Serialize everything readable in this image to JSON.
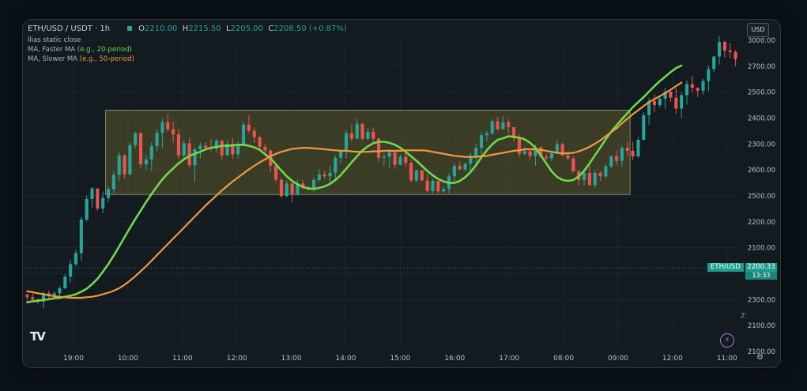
{
  "header": {
    "symbol": "ETH/USD / USDT · 1h",
    "o_label": "O",
    "o_value": "2210.00",
    "h_label": "H",
    "h_value": "2215.50",
    "l_label": "L",
    "l_value": "2205.00",
    "c_label": "C",
    "c_value": "2208.50",
    "change": "(+0.87%)",
    "sub1": "llias static  close",
    "ma_fast_label": "MA, Faster MA",
    "ma_fast_note": "(e.g., 20-period)",
    "ma_slow_label": "MA, Slower MA",
    "ma_slow_note": "(e.g., 50-period)"
  },
  "currency_button": "USD",
  "price_tag": {
    "name": "ETH/USD",
    "value": "2200.33",
    "time": "13:33"
  },
  "stray_mark": "2'",
  "colors": {
    "up": "#26a69a",
    "down": "#ef5350",
    "ma_fast": "#6fd94a",
    "ma_slow": "#f09a3e",
    "range_fill": "#5c5a2c",
    "range_border": "#8a8a6a"
  },
  "icons": {
    "logo": "tradingview-logo-icon",
    "bolt": "lightning-icon",
    "gear": "gear-icon"
  },
  "chart_data": {
    "type": "candlestick",
    "x_tick_labels": [
      "19:00",
      "10:00",
      "11:00",
      "12:00",
      "13:00",
      "14:00",
      "15:00",
      "16:00",
      "17:00",
      "08:00",
      "09:00",
      "12:00",
      "11:00"
    ],
    "y_tick_labels": [
      "3000.00",
      "2700.00",
      "2500.00",
      "2400.00",
      "2300.00",
      "2600.00",
      "2500.00",
      "2200.00",
      "2100.00",
      "2200.00",
      "2300.00",
      "2100.00",
      "2100.00"
    ],
    "ylim": [
      2160,
      2790
    ],
    "grid": true,
    "range_box": {
      "from_index": 15,
      "to_index": 111,
      "top": 2638,
      "bottom": 2470
    },
    "candles": [
      [
        2270,
        2272,
        2259,
        2265
      ],
      [
        2265,
        2272,
        2256,
        2261
      ],
      [
        2261,
        2263,
        2252,
        2256
      ],
      [
        2256,
        2277,
        2243,
        2273
      ],
      [
        2273,
        2279,
        2263,
        2267
      ],
      [
        2267,
        2277,
        2264,
        2273
      ],
      [
        2273,
        2287,
        2260,
        2283
      ],
      [
        2283,
        2311,
        2281,
        2306
      ],
      [
        2306,
        2339,
        2294,
        2331
      ],
      [
        2331,
        2360,
        2327,
        2353
      ],
      [
        2353,
        2425,
        2338,
        2420
      ],
      [
        2420,
        2468,
        2417,
        2461
      ],
      [
        2461,
        2485,
        2444,
        2482
      ],
      [
        2482,
        2480,
        2438,
        2442
      ],
      [
        2442,
        2476,
        2433,
        2463
      ],
      [
        2463,
        2486,
        2454,
        2481
      ],
      [
        2481,
        2516,
        2473,
        2509
      ],
      [
        2509,
        2555,
        2497,
        2548
      ],
      [
        2548,
        2550,
        2502,
        2510
      ],
      [
        2510,
        2573,
        2509,
        2568
      ],
      [
        2568,
        2595,
        2562,
        2592
      ],
      [
        2592,
        2595,
        2523,
        2530
      ],
      [
        2530,
        2548,
        2520,
        2540
      ],
      [
        2540,
        2574,
        2516,
        2566
      ],
      [
        2566,
        2600,
        2556,
        2593
      ],
      [
        2593,
        2621,
        2563,
        2614
      ],
      [
        2614,
        2630,
        2595,
        2600
      ],
      [
        2600,
        2615,
        2573,
        2590
      ],
      [
        2590,
        2601,
        2540,
        2548
      ],
      [
        2548,
        2578,
        2539,
        2572
      ],
      [
        2572,
        2583,
        2523,
        2528
      ],
      [
        2528,
        2564,
        2494,
        2560
      ],
      [
        2560,
        2574,
        2541,
        2567
      ],
      [
        2567,
        2574,
        2557,
        2563
      ],
      [
        2563,
        2580,
        2556,
        2561
      ],
      [
        2561,
        2581,
        2553,
        2577
      ],
      [
        2577,
        2579,
        2539,
        2548
      ],
      [
        2548,
        2578,
        2547,
        2571
      ],
      [
        2571,
        2582,
        2541,
        2550
      ],
      [
        2550,
        2576,
        2542,
        2568
      ],
      [
        2568,
        2614,
        2566,
        2609
      ],
      [
        2609,
        2628,
        2592,
        2597
      ],
      [
        2597,
        2603,
        2573,
        2584
      ],
      [
        2584,
        2588,
        2558,
        2565
      ],
      [
        2565,
        2571,
        2549,
        2558
      ],
      [
        2558,
        2560,
        2515,
        2527
      ],
      [
        2527,
        2531,
        2495,
        2499
      ],
      [
        2499,
        2503,
        2463,
        2467
      ],
      [
        2467,
        2498,
        2464,
        2492
      ],
      [
        2492,
        2491,
        2455,
        2471
      ],
      [
        2471,
        2499,
        2468,
        2492
      ],
      [
        2492,
        2498,
        2480,
        2483
      ],
      [
        2483,
        2487,
        2478,
        2480
      ],
      [
        2480,
        2504,
        2476,
        2499
      ],
      [
        2499,
        2520,
        2495,
        2510
      ],
      [
        2510,
        2517,
        2501,
        2506
      ],
      [
        2506,
        2527,
        2493,
        2513
      ],
      [
        2513,
        2548,
        2499,
        2543
      ],
      [
        2543,
        2560,
        2532,
        2557
      ],
      [
        2557,
        2598,
        2542,
        2592
      ],
      [
        2592,
        2610,
        2575,
        2581
      ],
      [
        2581,
        2621,
        2581,
        2611
      ],
      [
        2611,
        2612,
        2577,
        2581
      ],
      [
        2581,
        2602,
        2578,
        2595
      ],
      [
        2595,
        2604,
        2574,
        2581
      ],
      [
        2581,
        2583,
        2536,
        2543
      ],
      [
        2543,
        2553,
        2528,
        2545
      ],
      [
        2545,
        2560,
        2522,
        2554
      ],
      [
        2554,
        2559,
        2521,
        2529
      ],
      [
        2529,
        2550,
        2528,
        2545
      ],
      [
        2545,
        2557,
        2526,
        2533
      ],
      [
        2533,
        2540,
        2494,
        2498
      ],
      [
        2498,
        2520,
        2494,
        2518
      ],
      [
        2518,
        2519,
        2497,
        2498
      ],
      [
        2498,
        2510,
        2474,
        2477
      ],
      [
        2477,
        2501,
        2473,
        2497
      ],
      [
        2497,
        2497,
        2470,
        2476
      ],
      [
        2476,
        2486,
        2473,
        2481
      ],
      [
        2481,
        2512,
        2472,
        2506
      ],
      [
        2506,
        2531,
        2496,
        2527
      ],
      [
        2527,
        2536,
        2518,
        2520
      ],
      [
        2520,
        2534,
        2516,
        2531
      ],
      [
        2531,
        2553,
        2516,
        2547
      ],
      [
        2547,
        2571,
        2529,
        2563
      ],
      [
        2563,
        2593,
        2546,
        2588
      ],
      [
        2588,
        2597,
        2576,
        2592
      ],
      [
        2592,
        2620,
        2589,
        2616
      ],
      [
        2616,
        2624,
        2598,
        2600
      ],
      [
        2600,
        2626,
        2600,
        2614
      ],
      [
        2614,
        2620,
        2593,
        2604
      ],
      [
        2604,
        2604,
        2575,
        2582
      ],
      [
        2582,
        2590,
        2544,
        2551
      ],
      [
        2551,
        2565,
        2548,
        2556
      ],
      [
        2556,
        2558,
        2539,
        2547
      ],
      [
        2547,
        2569,
        2527,
        2564
      ],
      [
        2564,
        2566,
        2543,
        2545
      ],
      [
        2545,
        2551,
        2538,
        2542
      ],
      [
        2542,
        2557,
        2536,
        2552
      ],
      [
        2552,
        2580,
        2552,
        2570
      ],
      [
        2570,
        2573,
        2546,
        2548
      ],
      [
        2548,
        2556,
        2538,
        2542
      ],
      [
        2542,
        2546,
        2514,
        2516
      ],
      [
        2516,
        2518,
        2488,
        2499
      ],
      [
        2499,
        2520,
        2488,
        2513
      ],
      [
        2513,
        2527,
        2486,
        2489
      ],
      [
        2489,
        2518,
        2482,
        2513
      ],
      [
        2513,
        2516,
        2497,
        2506
      ],
      [
        2506,
        2530,
        2502,
        2526
      ],
      [
        2526,
        2548,
        2522,
        2546
      ],
      [
        2546,
        2557,
        2528,
        2537
      ],
      [
        2537,
        2567,
        2525,
        2563
      ],
      [
        2563,
        2575,
        2546,
        2557
      ],
      [
        2557,
        2575,
        2538,
        2546
      ],
      [
        2546,
        2585,
        2543,
        2579
      ],
      [
        2579,
        2634,
        2578,
        2628
      ],
      [
        2628,
        2663,
        2609,
        2656
      ],
      [
        2656,
        2670,
        2634,
        2648
      ],
      [
        2648,
        2665,
        2643,
        2661
      ],
      [
        2661,
        2683,
        2641,
        2675
      ],
      [
        2675,
        2676,
        2655,
        2663
      ],
      [
        2663,
        2682,
        2630,
        2641
      ],
      [
        2641,
        2673,
        2622,
        2668
      ],
      [
        2668,
        2697,
        2649,
        2690
      ],
      [
        2690,
        2707,
        2674,
        2683
      ],
      [
        2683,
        2682,
        2664,
        2677
      ],
      [
        2677,
        2701,
        2669,
        2696
      ],
      [
        2696,
        2727,
        2676,
        2720
      ],
      [
        2720,
        2747,
        2714,
        2745
      ],
      [
        2745,
        2786,
        2729,
        2774
      ],
      [
        2774,
        2776,
        2743,
        2757
      ],
      [
        2757,
        2772,
        2742,
        2754
      ],
      [
        2754,
        2758,
        2726,
        2740
      ]
    ],
    "series": [
      {
        "name": "MA, Faster MA",
        "values": [
          2255,
          2257,
          2258,
          2260,
          2261,
          2263,
          2264,
          2266,
          2268,
          2271,
          2276,
          2282,
          2291,
          2302,
          2316,
          2331,
          2348,
          2366,
          2385,
          2403,
          2421,
          2438,
          2455,
          2471,
          2486,
          2500,
          2512,
          2522,
          2532,
          2540,
          2547,
          2551,
          2555,
          2560,
          2563,
          2565,
          2567,
          2567,
          2568,
          2569,
          2569,
          2567,
          2564,
          2559,
          2550,
          2542,
          2530,
          2518,
          2506,
          2497,
          2490,
          2485,
          2482,
          2481,
          2483,
          2486,
          2491,
          2499,
          2509,
          2521,
          2534,
          2546,
          2558,
          2566,
          2572,
          2575,
          2575,
          2573,
          2569,
          2563,
          2555,
          2546,
          2537,
          2527,
          2517,
          2508,
          2501,
          2496,
          2493,
          2493,
          2497,
          2504,
          2515,
          2528,
          2544,
          2558,
          2570,
          2579,
          2582,
          2586,
          2585,
          2583,
          2580,
          2573,
          2563,
          2548,
          2532,
          2516,
          2505,
          2499,
          2497,
          2499,
          2506,
          2517,
          2532,
          2548,
          2564,
          2580,
          2595,
          2608,
          2620,
          2632,
          2644,
          2654,
          2664,
          2675,
          2686,
          2696,
          2705,
          2714,
          2722,
          2727
        ]
      },
      {
        "name": "MA, Slower MA",
        "values": [
          2277,
          2275,
          2273,
          2271,
          2269,
          2267,
          2266,
          2265,
          2264,
          2264,
          2264,
          2265,
          2266,
          2268,
          2271,
          2274,
          2278,
          2283,
          2290,
          2298,
          2307,
          2317,
          2327,
          2338,
          2349,
          2360,
          2371,
          2382,
          2393,
          2404,
          2415,
          2426,
          2437,
          2448,
          2458,
          2468,
          2478,
          2487,
          2496,
          2504,
          2512,
          2520,
          2527,
          2534,
          2540,
          2546,
          2551,
          2555,
          2558,
          2561,
          2562,
          2563,
          2563,
          2562,
          2561,
          2560,
          2559,
          2558,
          2557,
          2557,
          2556,
          2555,
          2555,
          2555,
          2556,
          2556,
          2557,
          2557,
          2557,
          2557,
          2558,
          2558,
          2558,
          2558,
          2557,
          2555,
          2553,
          2551,
          2549,
          2547,
          2546,
          2545,
          2545,
          2545,
          2546,
          2547,
          2549,
          2551,
          2553,
          2555,
          2557,
          2558,
          2560,
          2560,
          2560,
          2559,
          2557,
          2555,
          2553,
          2552,
          2552,
          2553,
          2556,
          2560,
          2565,
          2571,
          2578,
          2586,
          2594,
          2602,
          2612,
          2621,
          2630,
          2638,
          2646,
          2654,
          2660,
          2666,
          2672,
          2679,
          2686,
          2693
        ]
      }
    ]
  }
}
